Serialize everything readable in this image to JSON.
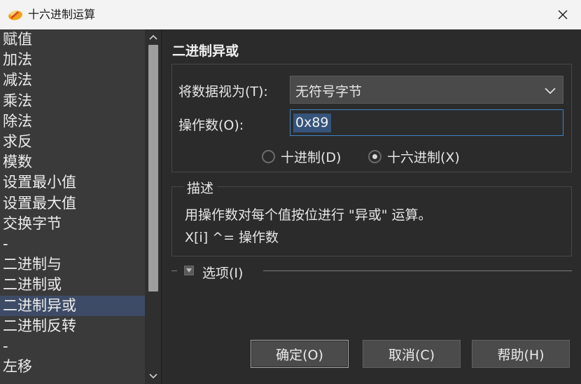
{
  "window": {
    "title": "十六进制运算",
    "close_glyph": "✕"
  },
  "operations": [
    {
      "label": "赋值"
    },
    {
      "label": "加法"
    },
    {
      "label": "减法"
    },
    {
      "label": "乘法"
    },
    {
      "label": "除法"
    },
    {
      "label": "求反"
    },
    {
      "label": "模数"
    },
    {
      "label": "设置最小值"
    },
    {
      "label": "设置最大值"
    },
    {
      "label": "交换字节"
    },
    {
      "label": "-"
    },
    {
      "label": "二进制与"
    },
    {
      "label": "二进制或"
    },
    {
      "label": "二进制异或",
      "selected": true
    },
    {
      "label": "二进制反转"
    },
    {
      "label": "-"
    },
    {
      "label": "左移"
    }
  ],
  "panel": {
    "title": "二进制异或",
    "treat_as_label": "将数据视为(T):",
    "treat_as_value": "无符号字节",
    "operand_label": "操作数(O):",
    "operand_value": "0x89",
    "radio_decimal": "十进制(D)",
    "radio_hex": "十六进制(X)",
    "radio_selected": "hex"
  },
  "description": {
    "title": "描述",
    "line1": "用操作数对每个值按位进行 \"异或\" 运算。",
    "line2": "X[i] ^= 操作数"
  },
  "options": {
    "label": "选项(I)",
    "collapsed_sign": "-"
  },
  "buttons": {
    "ok": "确定(O)",
    "cancel": "取消(C)",
    "help": "帮助(H)"
  },
  "colors": {
    "selection": "#3d4b66",
    "accent_border": "#3d84c6",
    "background": "#2b2b2b",
    "list_background": "#3a3a3a"
  },
  "icons": {
    "app": "hex-editor-app-icon",
    "close": "close-icon",
    "scroll_up": "chevron-up-icon",
    "scroll_down": "chevron-down-icon",
    "dropdown": "chevron-down-icon",
    "options": "collapse-icon"
  }
}
